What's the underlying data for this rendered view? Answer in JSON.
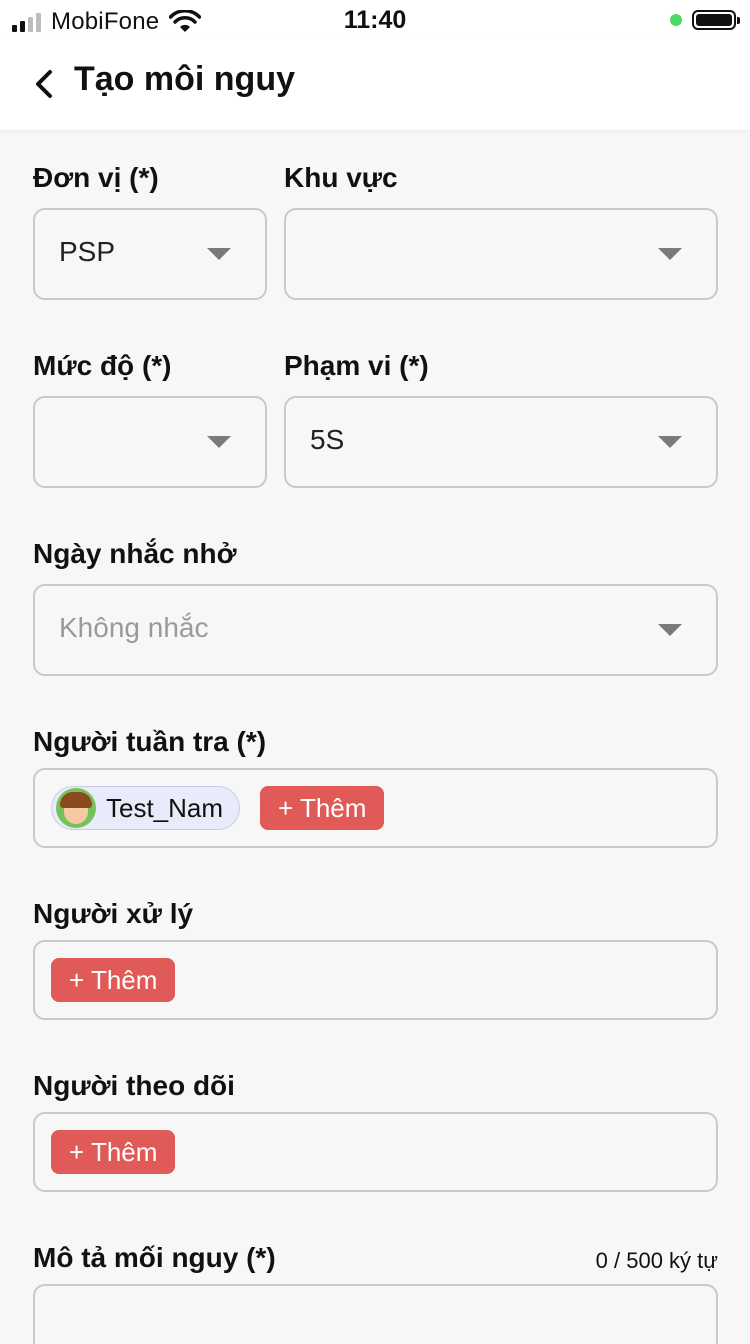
{
  "status_bar": {
    "carrier": "MobiFone",
    "time": "11:40"
  },
  "header": {
    "title": "Tạo môi nguy"
  },
  "form": {
    "don_vi": {
      "label": "Đơn vị (*)",
      "value": "PSP"
    },
    "khu_vuc": {
      "label": "Khu vực",
      "value": ""
    },
    "muc_do": {
      "label": "Mức độ (*)",
      "value": ""
    },
    "pham_vi": {
      "label": "Phạm vi (*)",
      "value": "5S"
    },
    "ngay_nhac_nho": {
      "label": "Ngày nhắc nhở",
      "placeholder": "Không nhắc"
    },
    "nguoi_tuan_tra": {
      "label": "Người tuần tra (*)",
      "chips": [
        {
          "name": "Test_Nam",
          "avatar": "boy-avatar-icon"
        }
      ],
      "add_label": "+ Thêm"
    },
    "nguoi_xu_ly": {
      "label": "Người xử lý",
      "add_label": "+ Thêm"
    },
    "nguoi_theo_doi": {
      "label": "Người theo dõi",
      "add_label": "+ Thêm"
    },
    "mo_ta": {
      "label": "Mô tả mối nguy (*)",
      "counter": "0 / 500 ký tự",
      "value": ""
    }
  },
  "colors": {
    "add_button": "#e05a57",
    "chip_background": "#e8ebfa",
    "battery_dot": "#4cd964"
  }
}
